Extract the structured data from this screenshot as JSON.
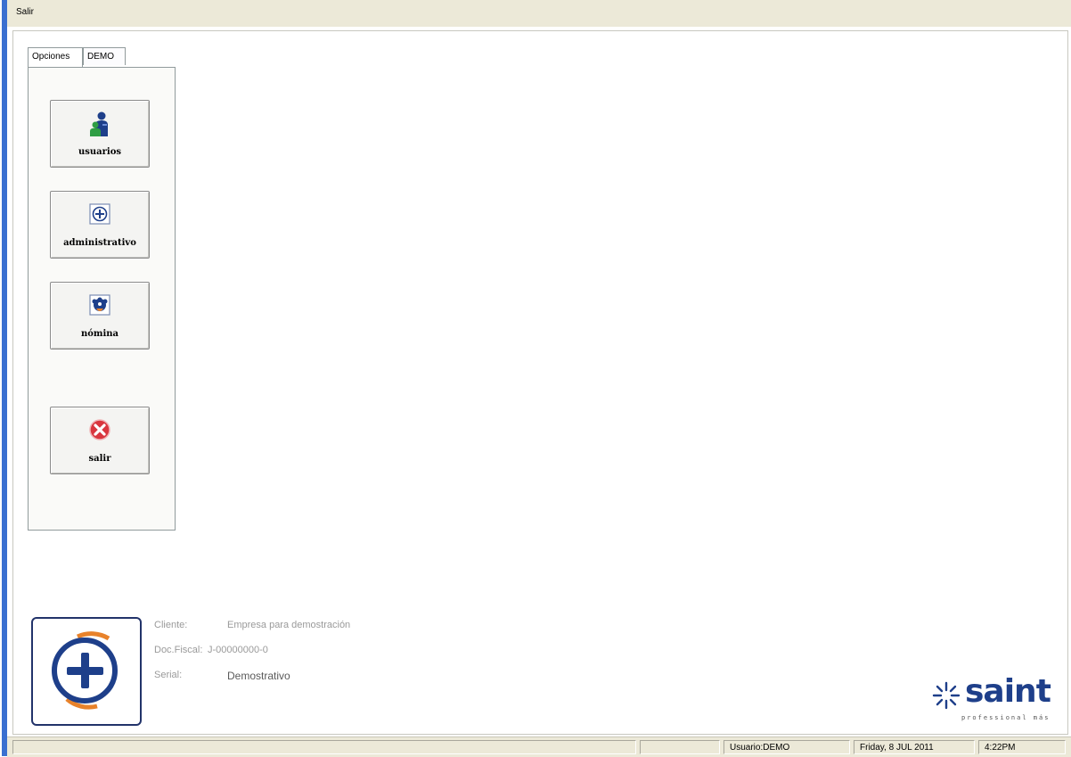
{
  "menu": {
    "items": [
      "Salir"
    ]
  },
  "tabs": [
    {
      "label": "Opciones"
    },
    {
      "label": "DEMO"
    }
  ],
  "options": [
    {
      "label": "usuarios",
      "icon": "users-icon"
    },
    {
      "label": "administrativo",
      "icon": "plus-circle-icon"
    },
    {
      "label": "nómina",
      "icon": "payroll-people-icon"
    },
    {
      "label": "salir",
      "icon": "exit-icon"
    }
  ],
  "info": {
    "cliente_label": "Cliente:",
    "cliente_value": "Empresa para demostración",
    "docfiscal_label": "Doc.Fiscal:",
    "docfiscal_value": "J-00000000-0",
    "serial_label": "Serial:",
    "serial_value": "Demostrativo"
  },
  "brand": {
    "name": "saint",
    "tagline": "professional más"
  },
  "status": {
    "user": "Usuario:DEMO",
    "date": "Friday,  8 JUL 2011",
    "time": "4:22PM"
  },
  "colors": {
    "brand_blue": "#1e3f8a",
    "accent_orange": "#e8822a",
    "exit_red": "#d9363e",
    "xp_blue": "#3a6fd0"
  }
}
